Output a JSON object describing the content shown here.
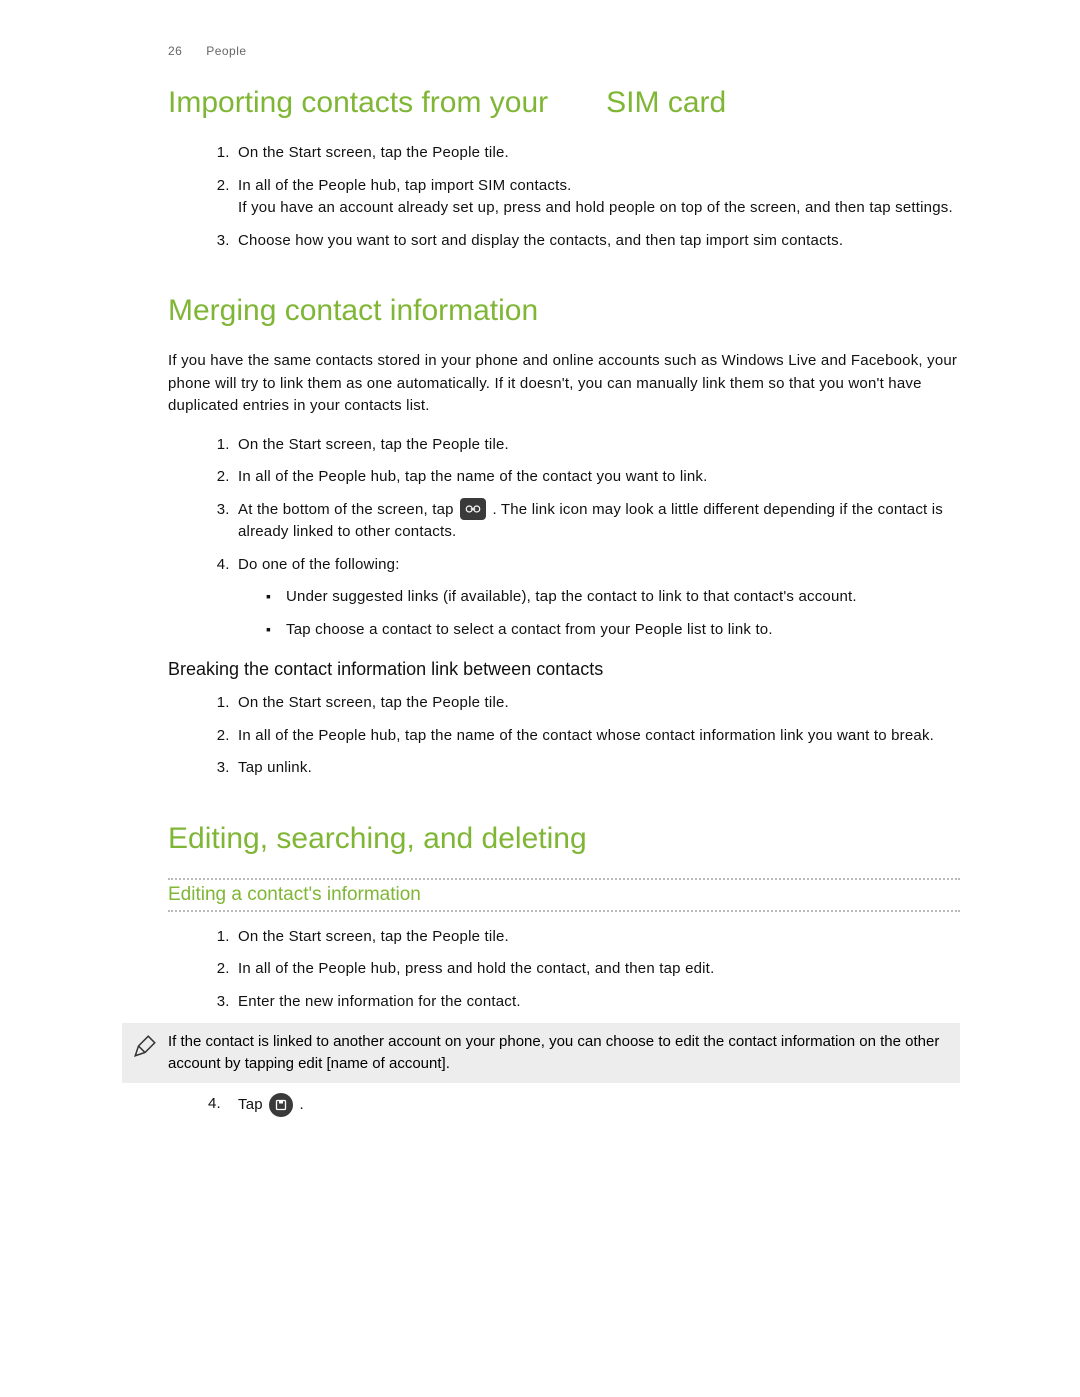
{
  "header": {
    "page_num": "26",
    "section": "People"
  },
  "s1": {
    "title_a": "Importing contacts from your",
    "title_b": "SIM card",
    "steps": {
      "1a": "On the Start screen, tap the ",
      "1b": "People",
      "1c": " tile.",
      "2a": "In ",
      "2b": "all",
      "2c": " of the People hub, tap ",
      "2d": "import SIM contacts",
      "2e": ".",
      "2f": "If you have an account already set up, press and hold ",
      "2g": "people",
      "2h": " on top of the screen, and then tap ",
      "2i": "settings",
      "2j": ".",
      "3a": "Choose how you want to sort and display the contacts, and then tap ",
      "3b": "import sim contacts",
      "3c": "."
    }
  },
  "s2": {
    "title": "Merging contact information",
    "lead": "If you have the same contacts stored in your phone and online accounts such as Windows Live and Facebook, your phone will try to link them as one automatically. If it doesn't, you can manually link them so that you won't have duplicated entries in your contacts list.",
    "steps": {
      "1a": "On the Start screen, tap the ",
      "1b": "People",
      "1c": " tile.",
      "2a": "In ",
      "2b": "all",
      "2c": " of the People hub, tap the name of the contact you want to link.",
      "3a": "At the bottom of the screen, tap ",
      "3b": ". The link icon may look a little different depending if the contact is already linked to other contacts.",
      "4": "Do one of the following:",
      "4_b1a": "Under ",
      "4_b1b": "suggested links",
      "4_b1c": " (if available), tap the contact to link to that contact's account.",
      "4_b2a": "Tap ",
      "4_b2b": "choose a contact",
      "4_b2c": " to select a contact from your People list to link to."
    },
    "sub_title": "Breaking the contact information link between contacts",
    "sub_steps": {
      "1a": "On the Start screen, tap the ",
      "1b": "People",
      "1c": " tile.",
      "2a": "In ",
      "2b": "all",
      "2c": " of the People hub, tap the name of the contact whose contact information link you want to break.",
      "3a": "Tap ",
      "3b": "unlink",
      "3c": "."
    }
  },
  "s3": {
    "title": "Editing, searching, and deleting",
    "subsection": "Editing a contact's information",
    "steps": {
      "1a": "On the Start screen, tap the ",
      "1b": "People",
      "1c": " tile.",
      "2a": "In ",
      "2b": "all",
      "2c": " of the People hub, press and hold the contact, and then tap ",
      "2d": "edit",
      "2e": ".",
      "3": "Enter the new information for the contact."
    },
    "note_a": "If the contact is linked to another account on your phone, you can choose to edit the contact information on the other account by tapping ",
    "note_b": "edit [name of account]",
    "note_c": ".",
    "step4a": "Tap ",
    "step4b": "."
  }
}
